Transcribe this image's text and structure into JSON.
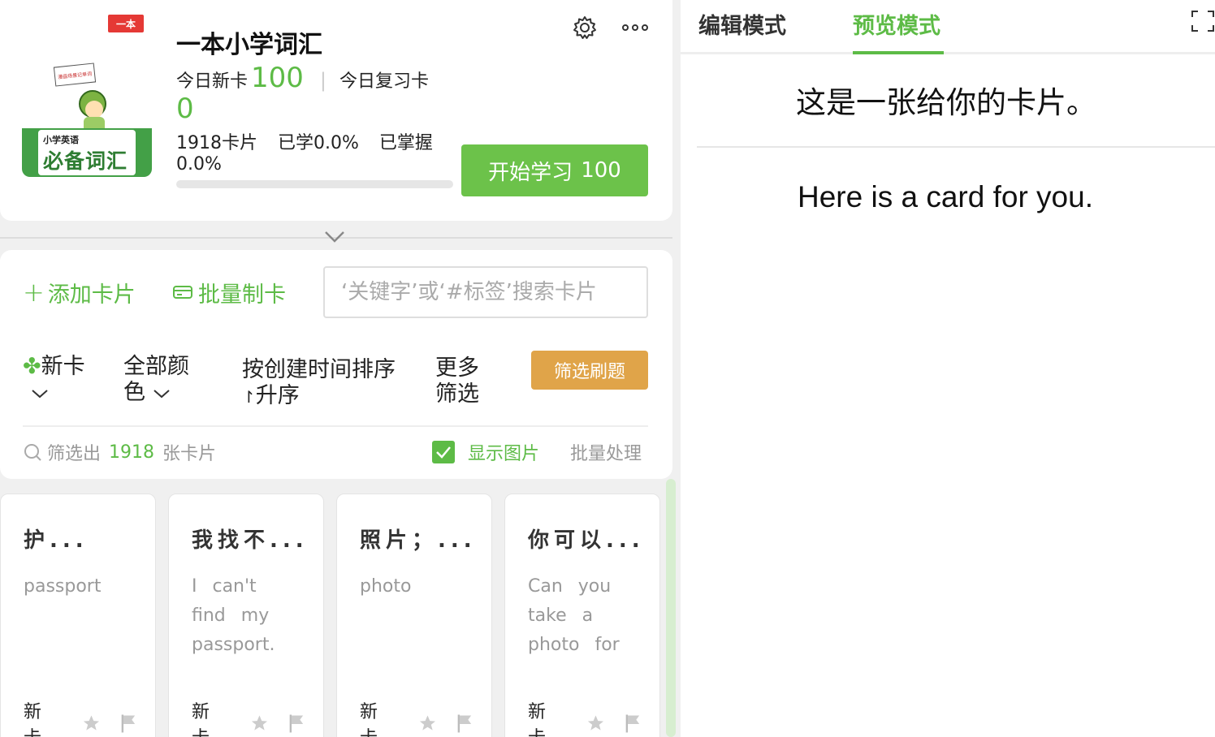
{
  "deck": {
    "cover": {
      "logo": "一本",
      "sign": "漫画场景记单词",
      "subtitle": "小学英语",
      "title": "必备词汇"
    },
    "title": "一本小学词汇",
    "today_new_label": "今日新卡",
    "today_new_count": "100",
    "today_review_label": "今日复习卡",
    "today_review_count": "0",
    "total_cards": "1918卡片",
    "learned": "已学0.0%",
    "mastered_label": "已掌握",
    "mastered_value": "0.0%",
    "progress_fraction": 0.0,
    "start_label": "开始学习",
    "start_count": "100"
  },
  "toolbar": {
    "add_card": "添加卡片",
    "batch_make": "批量制卡",
    "search_placeholder": "‘关键字’或‘#标签’搜索卡片"
  },
  "filters": {
    "new": "新卡",
    "color": "全部颜色",
    "sort": "按创建时间排序",
    "sort_order": "升序",
    "more": "更多筛选",
    "screen_button": "筛选刷题"
  },
  "result": {
    "prefix": "筛选出",
    "count": "1918",
    "suffix": "张卡片",
    "show_images": "显示图片",
    "show_images_checked": true,
    "batch_op": "批量处理"
  },
  "cards": [
    {
      "title": "护...",
      "body": "passport",
      "status": "新卡"
    },
    {
      "title": "我找不...",
      "body": "I can't find my passport.",
      "status": "新卡"
    },
    {
      "title": "照片；...",
      "body": "photo",
      "status": "新卡"
    },
    {
      "title": "你可以...",
      "body": "Can you take a photo for",
      "status": "新卡"
    }
  ],
  "preview": {
    "tab_edit": "编辑模式",
    "tab_preview": "预览模式",
    "active_tab": "预览模式",
    "front": "这是一张给你的卡片。",
    "back": "Here is a card for you."
  },
  "colors": {
    "accent": "#5dbb46",
    "orange": "#e0a449"
  }
}
